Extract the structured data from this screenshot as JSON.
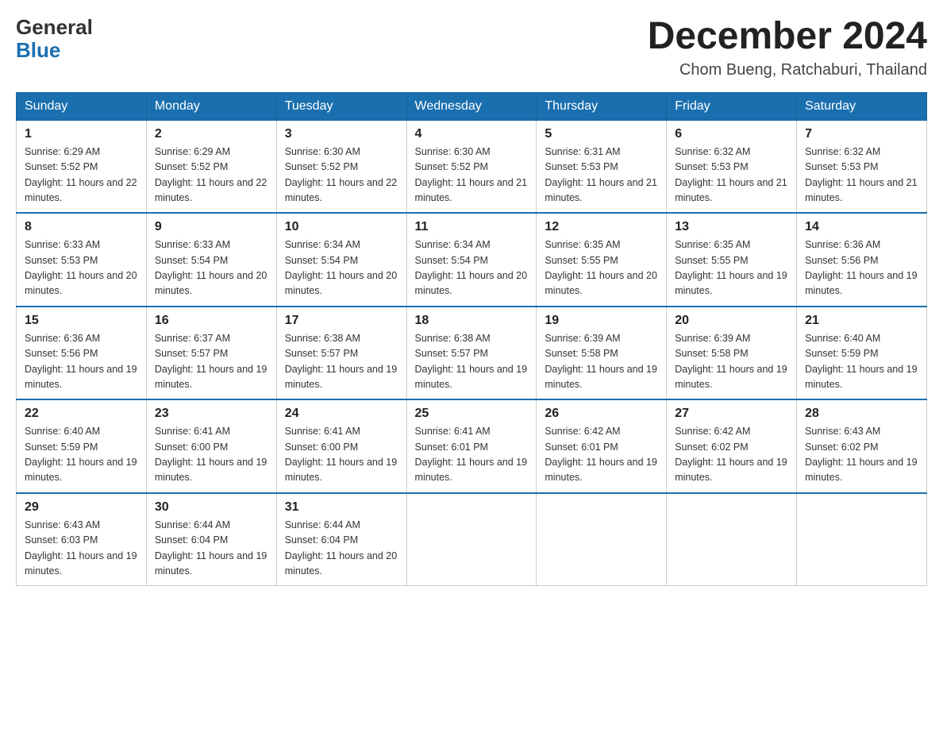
{
  "header": {
    "logo_general": "General",
    "logo_blue": "Blue",
    "month_title": "December 2024",
    "location": "Chom Bueng, Ratchaburi, Thailand"
  },
  "weekdays": [
    "Sunday",
    "Monday",
    "Tuesday",
    "Wednesday",
    "Thursday",
    "Friday",
    "Saturday"
  ],
  "weeks": [
    [
      {
        "day": "1",
        "sunrise": "6:29 AM",
        "sunset": "5:52 PM",
        "daylight": "11 hours and 22 minutes."
      },
      {
        "day": "2",
        "sunrise": "6:29 AM",
        "sunset": "5:52 PM",
        "daylight": "11 hours and 22 minutes."
      },
      {
        "day": "3",
        "sunrise": "6:30 AM",
        "sunset": "5:52 PM",
        "daylight": "11 hours and 22 minutes."
      },
      {
        "day": "4",
        "sunrise": "6:30 AM",
        "sunset": "5:52 PM",
        "daylight": "11 hours and 21 minutes."
      },
      {
        "day": "5",
        "sunrise": "6:31 AM",
        "sunset": "5:53 PM",
        "daylight": "11 hours and 21 minutes."
      },
      {
        "day": "6",
        "sunrise": "6:32 AM",
        "sunset": "5:53 PM",
        "daylight": "11 hours and 21 minutes."
      },
      {
        "day": "7",
        "sunrise": "6:32 AM",
        "sunset": "5:53 PM",
        "daylight": "11 hours and 21 minutes."
      }
    ],
    [
      {
        "day": "8",
        "sunrise": "6:33 AM",
        "sunset": "5:53 PM",
        "daylight": "11 hours and 20 minutes."
      },
      {
        "day": "9",
        "sunrise": "6:33 AM",
        "sunset": "5:54 PM",
        "daylight": "11 hours and 20 minutes."
      },
      {
        "day": "10",
        "sunrise": "6:34 AM",
        "sunset": "5:54 PM",
        "daylight": "11 hours and 20 minutes."
      },
      {
        "day": "11",
        "sunrise": "6:34 AM",
        "sunset": "5:54 PM",
        "daylight": "11 hours and 20 minutes."
      },
      {
        "day": "12",
        "sunrise": "6:35 AM",
        "sunset": "5:55 PM",
        "daylight": "11 hours and 20 minutes."
      },
      {
        "day": "13",
        "sunrise": "6:35 AM",
        "sunset": "5:55 PM",
        "daylight": "11 hours and 19 minutes."
      },
      {
        "day": "14",
        "sunrise": "6:36 AM",
        "sunset": "5:56 PM",
        "daylight": "11 hours and 19 minutes."
      }
    ],
    [
      {
        "day": "15",
        "sunrise": "6:36 AM",
        "sunset": "5:56 PM",
        "daylight": "11 hours and 19 minutes."
      },
      {
        "day": "16",
        "sunrise": "6:37 AM",
        "sunset": "5:57 PM",
        "daylight": "11 hours and 19 minutes."
      },
      {
        "day": "17",
        "sunrise": "6:38 AM",
        "sunset": "5:57 PM",
        "daylight": "11 hours and 19 minutes."
      },
      {
        "day": "18",
        "sunrise": "6:38 AM",
        "sunset": "5:57 PM",
        "daylight": "11 hours and 19 minutes."
      },
      {
        "day": "19",
        "sunrise": "6:39 AM",
        "sunset": "5:58 PM",
        "daylight": "11 hours and 19 minutes."
      },
      {
        "day": "20",
        "sunrise": "6:39 AM",
        "sunset": "5:58 PM",
        "daylight": "11 hours and 19 minutes."
      },
      {
        "day": "21",
        "sunrise": "6:40 AM",
        "sunset": "5:59 PM",
        "daylight": "11 hours and 19 minutes."
      }
    ],
    [
      {
        "day": "22",
        "sunrise": "6:40 AM",
        "sunset": "5:59 PM",
        "daylight": "11 hours and 19 minutes."
      },
      {
        "day": "23",
        "sunrise": "6:41 AM",
        "sunset": "6:00 PM",
        "daylight": "11 hours and 19 minutes."
      },
      {
        "day": "24",
        "sunrise": "6:41 AM",
        "sunset": "6:00 PM",
        "daylight": "11 hours and 19 minutes."
      },
      {
        "day": "25",
        "sunrise": "6:41 AM",
        "sunset": "6:01 PM",
        "daylight": "11 hours and 19 minutes."
      },
      {
        "day": "26",
        "sunrise": "6:42 AM",
        "sunset": "6:01 PM",
        "daylight": "11 hours and 19 minutes."
      },
      {
        "day": "27",
        "sunrise": "6:42 AM",
        "sunset": "6:02 PM",
        "daylight": "11 hours and 19 minutes."
      },
      {
        "day": "28",
        "sunrise": "6:43 AM",
        "sunset": "6:02 PM",
        "daylight": "11 hours and 19 minutes."
      }
    ],
    [
      {
        "day": "29",
        "sunrise": "6:43 AM",
        "sunset": "6:03 PM",
        "daylight": "11 hours and 19 minutes."
      },
      {
        "day": "30",
        "sunrise": "6:44 AM",
        "sunset": "6:04 PM",
        "daylight": "11 hours and 19 minutes."
      },
      {
        "day": "31",
        "sunrise": "6:44 AM",
        "sunset": "6:04 PM",
        "daylight": "11 hours and 20 minutes."
      },
      null,
      null,
      null,
      null
    ]
  ]
}
